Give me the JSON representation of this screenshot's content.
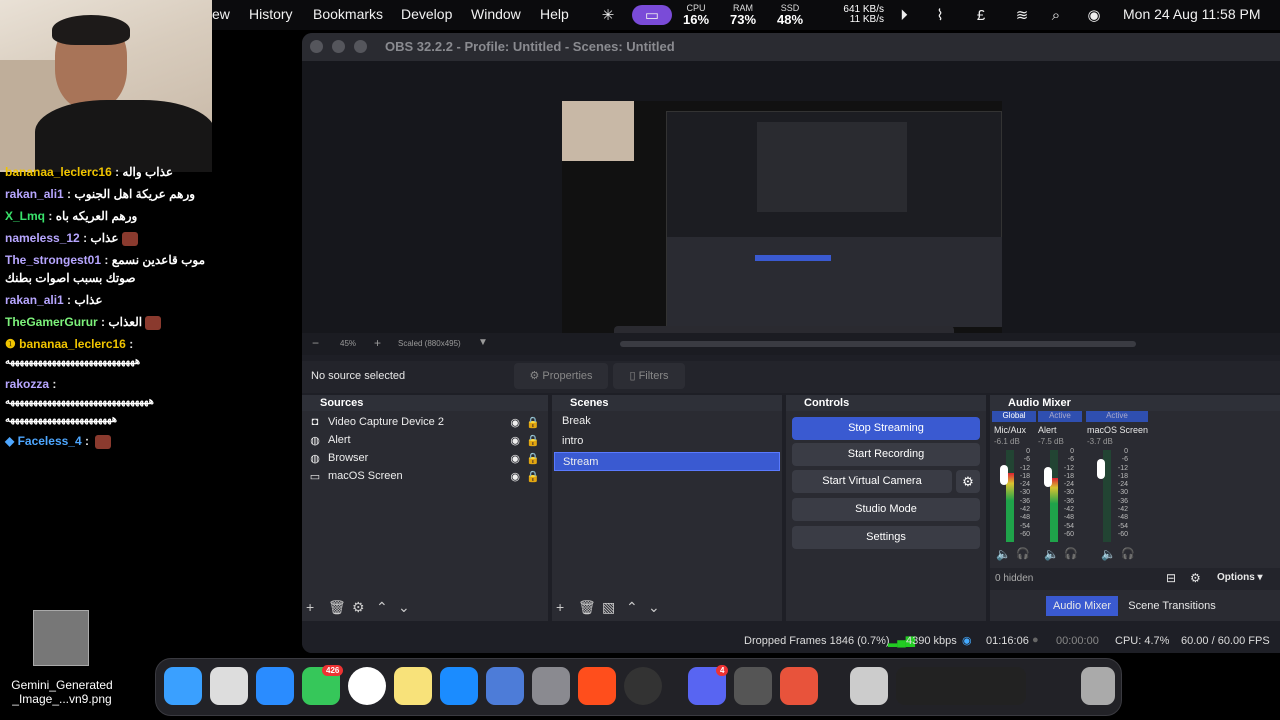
{
  "menubar": {
    "items": [
      "ew",
      "History",
      "Bookmarks",
      "Develop",
      "Window",
      "Help"
    ],
    "cpu": {
      "label": "CPU",
      "value": "16%"
    },
    "ram": {
      "label": "RAM",
      "value": "73%"
    },
    "ssd": {
      "label": "SSD",
      "value": "48%"
    },
    "net_up": "641 KB/s",
    "net_down": "11 KB/s",
    "clock": "Mon 24 Aug  11:58 PM"
  },
  "chat": [
    {
      "user": "bananaa_leclerc16",
      "msg": "عذاب واله",
      "color": "#f0c400"
    },
    {
      "user": "rakan_ali1",
      "msg": "ورهم عريكة اهل الجنوب",
      "color": "#b7a6ff"
    },
    {
      "user": "X_Lmq",
      "msg": "ورهم العريكه باه",
      "color": "#39e36b"
    },
    {
      "user": "nameless_12",
      "msg": "عذاب",
      "color": "#b7a6ff"
    },
    {
      "user": "The_strongest01",
      "msg": "موب قاعدين نسمع",
      "color": "#b7a6ff"
    },
    {
      "user": "",
      "msg": "صوتك بسبب اصوات بطنك",
      "color": "#fff"
    },
    {
      "user": "rakan_ali1",
      "msg": "عذاب",
      "color": "#b7a6ff"
    },
    {
      "user": "TheGamerGurur",
      "msg": "العذاب",
      "color": "#7df27b"
    },
    {
      "user": "bananaa_leclerc16",
      "msg": "",
      "color": "#f0c400"
    },
    {
      "user": "",
      "msg": "ههههههههههههههههههههههههههههه",
      "color": "#fff"
    },
    {
      "user": "rakozza",
      "msg": "",
      "color": "#b7a6ff"
    },
    {
      "user": "",
      "msg": "هههههههههههههههههههههههههههههههه",
      "color": "#fff"
    },
    {
      "user": "",
      "msg": "هههههههههههههههههههههههه",
      "color": "#fff"
    },
    {
      "user": "Faceless_4",
      "msg": "",
      "color": "#4ea7ff"
    }
  ],
  "desktop_file": {
    "name": "Gemini_Generated\n_Image_...vn9.png",
    "line1": "Gemini_Generated",
    "line2": "_Image_...vn9.png"
  },
  "obs": {
    "title": "OBS 32.2.2 - Profile: Untitled - Scenes: Untitled",
    "zoom": "45%",
    "scaled": "Scaled (880x495)",
    "no_source": "No source selected",
    "properties": "Properties",
    "filters": "Filters",
    "sources_header": "Sources",
    "sources": [
      "Video Capture Device 2",
      "Alert",
      "Browser",
      "macOS Screen"
    ],
    "scenes_header": "Scenes",
    "scenes": [
      "Break",
      "intro",
      "Stream"
    ],
    "controls_header": "Controls",
    "controls": {
      "stop_streaming": "Stop Streaming",
      "start_recording": "Start Recording",
      "start_virtual_camera": "Start Virtual Camera",
      "studio_mode": "Studio Mode",
      "settings": "Settings"
    },
    "mixer_header": "Audio Mixer",
    "mixer_tabs": [
      "Global",
      "Active",
      "Active"
    ],
    "channels": [
      {
        "name": "Mic/Aux",
        "db": "-6.1 dB",
        "level": 0.75
      },
      {
        "name": "Alert",
        "db": "-7.5 dB",
        "level": 0.7
      },
      {
        "name": "macOS Screen",
        "db": "-3.7 dB",
        "level": 0.0
      }
    ],
    "scale": [
      "0",
      "-6",
      "-12",
      "-18",
      "-24",
      "-30",
      "-36",
      "-42",
      "-48",
      "-54",
      "-60"
    ],
    "hidden": "0 hidden",
    "options": "Options",
    "bottom_tabs": [
      "Audio Mixer",
      "Scene Transitions"
    ],
    "status": {
      "dropped": "Dropped Frames 1846 (0.7%)",
      "kbps": "4390 kbps",
      "stream_time": "01:16:06",
      "rec_time": "00:00:00",
      "cpu": "CPU: 4.7%",
      "fps": "60.00 / 60.00 FPS"
    }
  },
  "dock": {
    "messages_badge": "426",
    "discord_badge": "4"
  },
  "colors": {
    "accent": "#3a5ad1",
    "bg": "#1e1f26"
  }
}
